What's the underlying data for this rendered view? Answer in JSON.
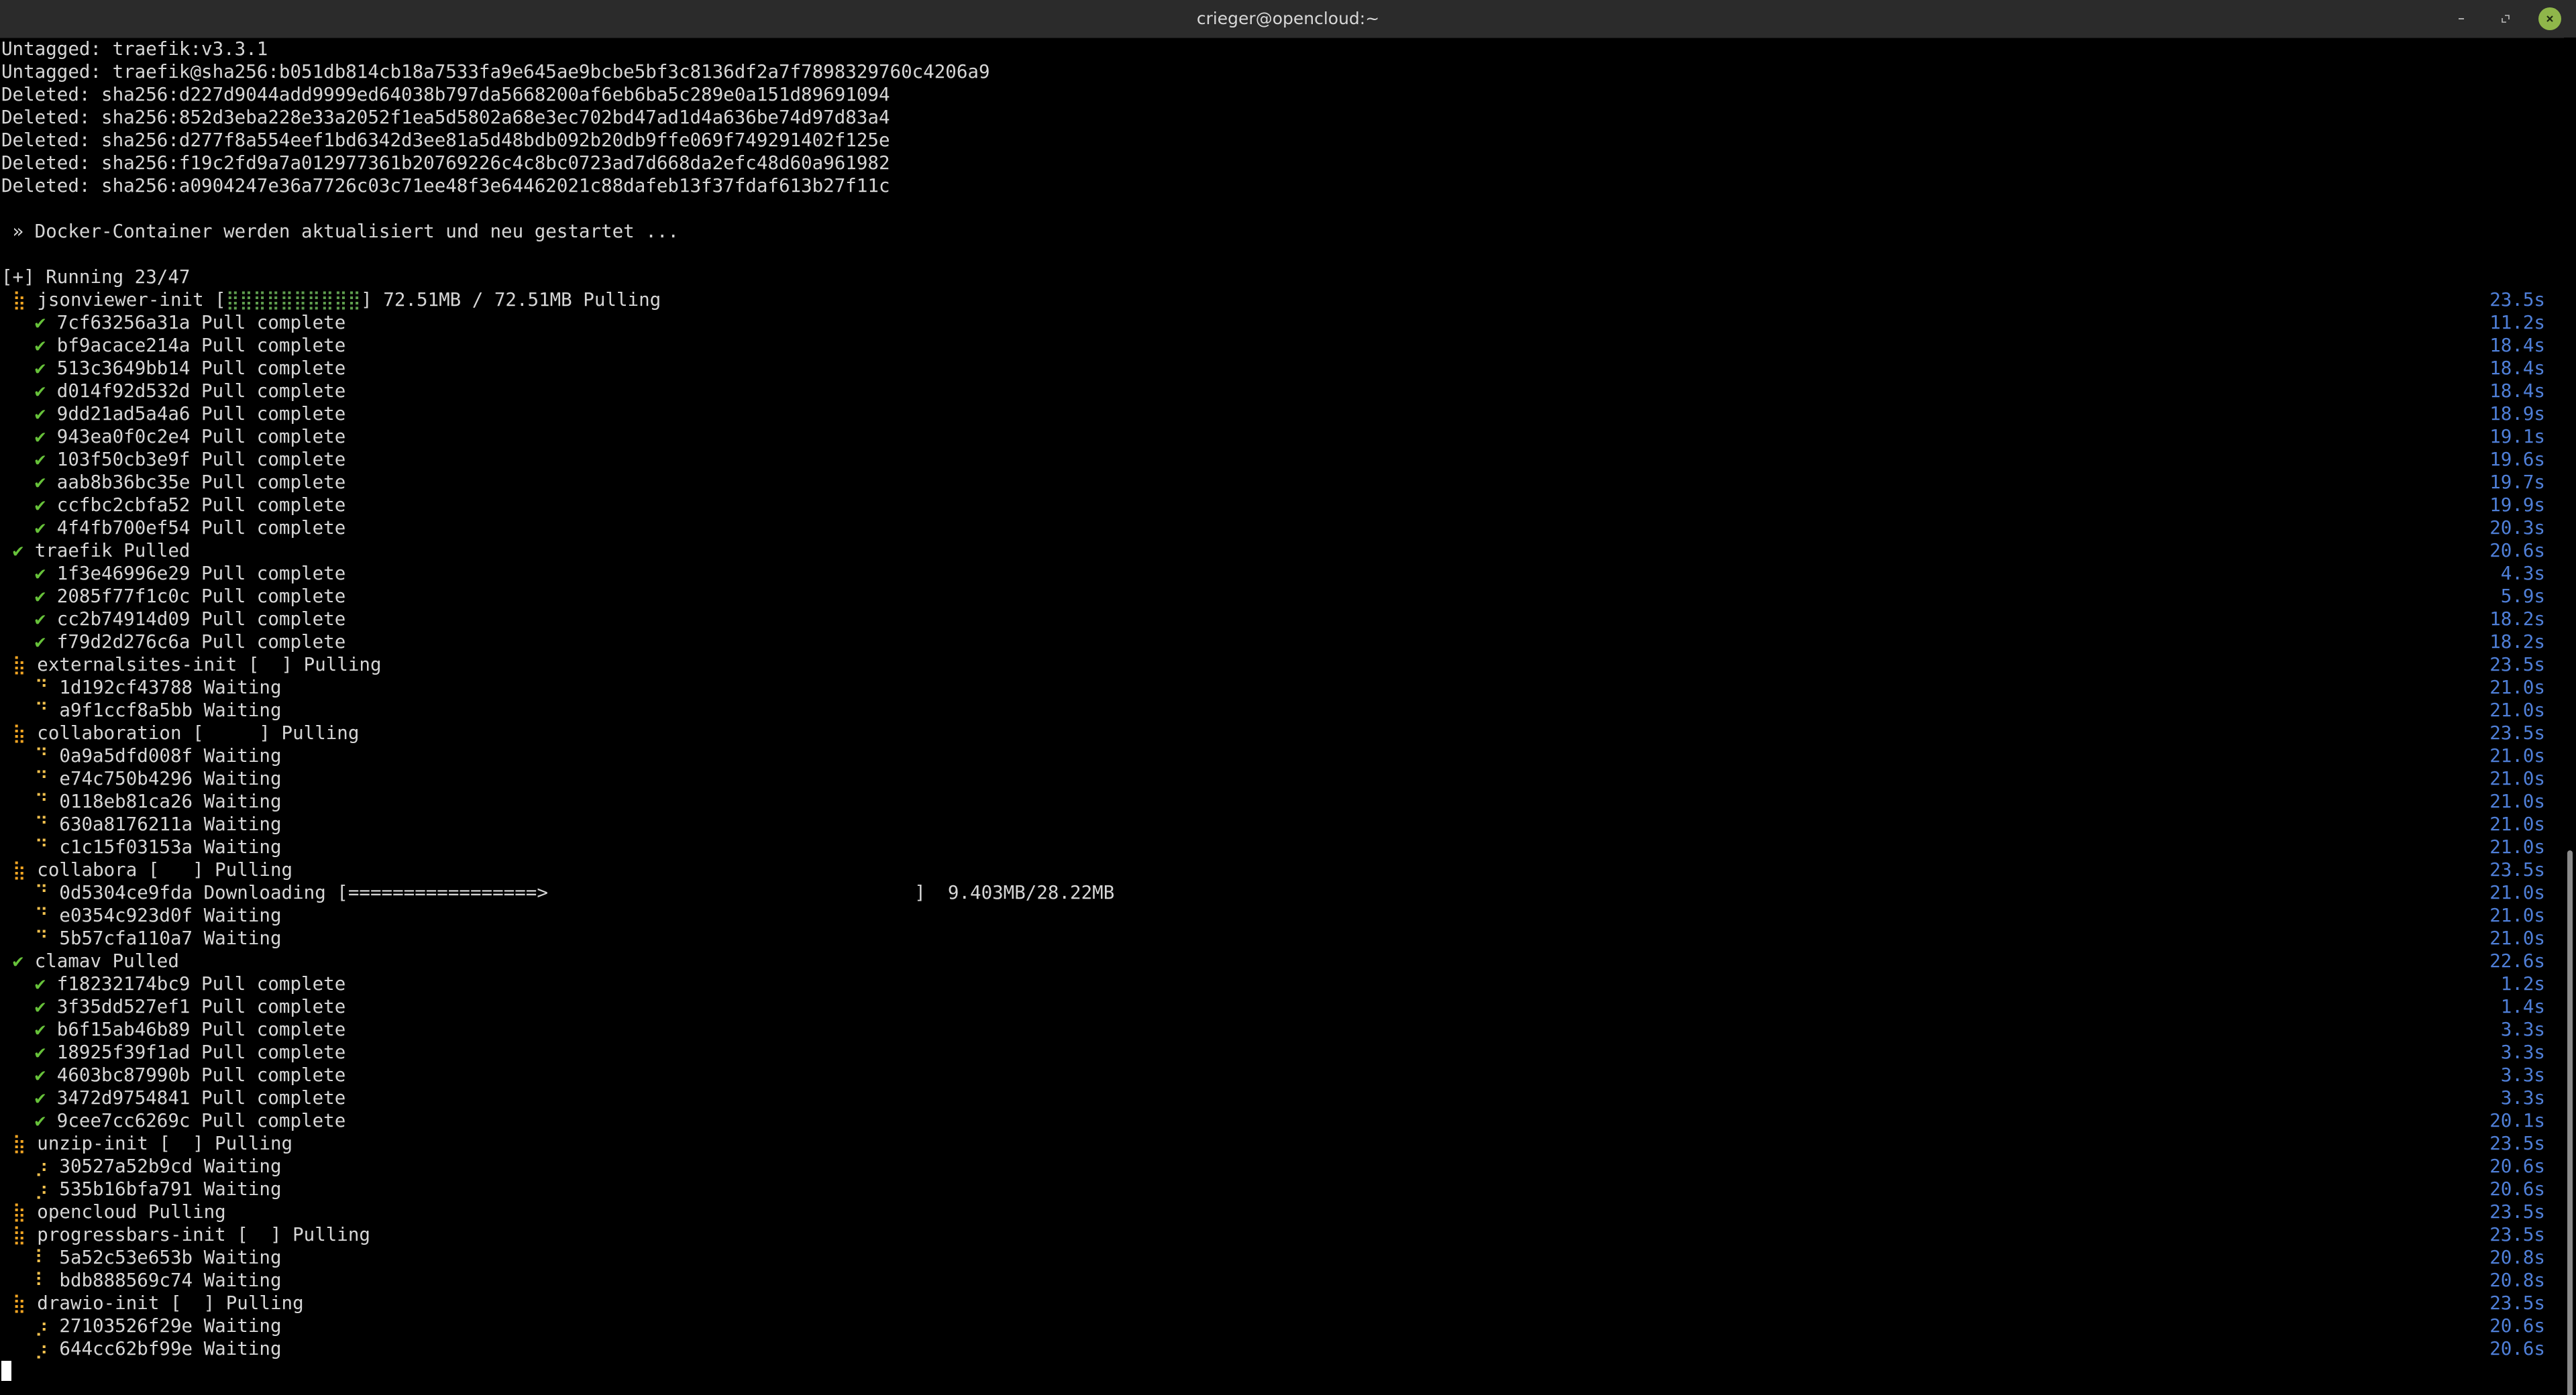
{
  "window": {
    "title": "crieger@opencloud:~"
  },
  "icons": {
    "minimize": "minimize-icon",
    "maximize": "maximize-icon",
    "close": "close-icon"
  },
  "colors": {
    "background": "#000000",
    "text": "#d6d6d6",
    "duration": "#4f7fd8",
    "check": "#67c23a",
    "spinner": "#f5a623",
    "close_button": "#8fb64a"
  },
  "terminal": {
    "pre_lines": [
      "Untagged: traefik:v3.3.1",
      "Untagged: traefik@sha256:b051db814cb18a7533fa9e645ae9bcbe5bf3c8136df2a7f7898329760c4206a9",
      "Deleted: sha256:d227d9044add9999ed64038b797da5668200af6eb6ba5c289e0a151d89691094",
      "Deleted: sha256:852d3eba228e33a2052f1ea5d5802a68e3ec702bd47ad1d4a636be74d97d83a4",
      "Deleted: sha256:d277f8a554eef1bd6342d3ee81a5d48bdb092b20db9ffe069f749291402f125e",
      "Deleted: sha256:f19c2fd9a7a012977361b20769226c4c8bc0723ad7d668da2efc48d60a961982",
      "Deleted: sha256:a0904247e36a7726c03c71ee48f3e64462021c88dafeb13f37fdaf613b27f11c",
      "",
      " » Docker-Container werden aktualisiert und neu gestartet ...",
      "",
      "[+] Running 23/47"
    ],
    "status_lines": [
      {
        "icon": "⣷",
        "kind": "spin",
        "indent": 1,
        "text": "jsonviewer-init [",
        "bar": "⣿⣿⣿⣿⣿⣿⣿⣿⣿⣿",
        "text2": "] 72.51MB / 72.51MB Pulling",
        "duration": "23.5s"
      },
      {
        "icon": "✔",
        "kind": "ok",
        "indent": 3,
        "text": "7cf63256a31a Pull complete",
        "duration": "11.2s"
      },
      {
        "icon": "✔",
        "kind": "ok",
        "indent": 3,
        "text": "bf9acace214a Pull complete",
        "duration": "18.4s"
      },
      {
        "icon": "✔",
        "kind": "ok",
        "indent": 3,
        "text": "513c3649bb14 Pull complete",
        "duration": "18.4s"
      },
      {
        "icon": "✔",
        "kind": "ok",
        "indent": 3,
        "text": "d014f92d532d Pull complete",
        "duration": "18.4s"
      },
      {
        "icon": "✔",
        "kind": "ok",
        "indent": 3,
        "text": "9dd21ad5a4a6 Pull complete",
        "duration": "18.9s"
      },
      {
        "icon": "✔",
        "kind": "ok",
        "indent": 3,
        "text": "943ea0f0c2e4 Pull complete",
        "duration": "19.1s"
      },
      {
        "icon": "✔",
        "kind": "ok",
        "indent": 3,
        "text": "103f50cb3e9f Pull complete",
        "duration": "19.6s"
      },
      {
        "icon": "✔",
        "kind": "ok",
        "indent": 3,
        "text": "aab8b36bc35e Pull complete",
        "duration": "19.7s"
      },
      {
        "icon": "✔",
        "kind": "ok",
        "indent": 3,
        "text": "ccfbc2cbfa52 Pull complete",
        "duration": "19.9s"
      },
      {
        "icon": "✔",
        "kind": "ok",
        "indent": 3,
        "text": "4f4fb700ef54 Pull complete",
        "duration": "20.3s"
      },
      {
        "icon": "✔",
        "kind": "ok",
        "indent": 1,
        "text": "traefik Pulled",
        "duration": "20.6s"
      },
      {
        "icon": "✔",
        "kind": "ok",
        "indent": 3,
        "text": "1f3e46996e29 Pull complete",
        "duration": "4.3s"
      },
      {
        "icon": "✔",
        "kind": "ok",
        "indent": 3,
        "text": "2085f77f1c0c Pull complete",
        "duration": "5.9s"
      },
      {
        "icon": "✔",
        "kind": "ok",
        "indent": 3,
        "text": "cc2b74914d09 Pull complete",
        "duration": "18.2s"
      },
      {
        "icon": "✔",
        "kind": "ok",
        "indent": 3,
        "text": "f79d2d276c6a Pull complete",
        "duration": "18.2s"
      },
      {
        "icon": "⣷",
        "kind": "spin",
        "indent": 1,
        "text": "externalsites-init [  ] Pulling",
        "duration": "23.5s"
      },
      {
        "icon": "⠙",
        "kind": "wait",
        "indent": 3,
        "text": "1d192cf43788 Waiting",
        "duration": "21.0s"
      },
      {
        "icon": "⠙",
        "kind": "wait",
        "indent": 3,
        "text": "a9f1ccf8a5bb Waiting",
        "duration": "21.0s"
      },
      {
        "icon": "⣷",
        "kind": "spin",
        "indent": 1,
        "text": "collaboration [     ] Pulling",
        "duration": "23.5s"
      },
      {
        "icon": "⠙",
        "kind": "wait",
        "indent": 3,
        "text": "0a9a5dfd008f Waiting",
        "duration": "21.0s"
      },
      {
        "icon": "⠙",
        "kind": "wait",
        "indent": 3,
        "text": "e74c750b4296 Waiting",
        "duration": "21.0s"
      },
      {
        "icon": "⠙",
        "kind": "wait",
        "indent": 3,
        "text": "0118eb81ca26 Waiting",
        "duration": "21.0s"
      },
      {
        "icon": "⠙",
        "kind": "wait",
        "indent": 3,
        "text": "630a8176211a Waiting",
        "duration": "21.0s"
      },
      {
        "icon": "⠙",
        "kind": "wait",
        "indent": 3,
        "text": "c1c15f03153a Waiting",
        "duration": "21.0s"
      },
      {
        "icon": "⣷",
        "kind": "spin",
        "indent": 1,
        "text": "collabora [   ] Pulling",
        "duration": "23.5s"
      },
      {
        "icon": "⠙",
        "kind": "wait",
        "indent": 3,
        "text": "0d5304ce9fda Downloading [=================>                                 ]  9.403MB/28.22MB",
        "duration": "21.0s"
      },
      {
        "icon": "⠙",
        "kind": "wait",
        "indent": 3,
        "text": "e0354c923d0f Waiting",
        "duration": "21.0s"
      },
      {
        "icon": "⠙",
        "kind": "wait",
        "indent": 3,
        "text": "5b57cfa110a7 Waiting",
        "duration": "21.0s"
      },
      {
        "icon": "✔",
        "kind": "ok",
        "indent": 1,
        "text": "clamav Pulled",
        "duration": "22.6s"
      },
      {
        "icon": "✔",
        "kind": "ok",
        "indent": 3,
        "text": "f18232174bc9 Pull complete",
        "duration": "1.2s"
      },
      {
        "icon": "✔",
        "kind": "ok",
        "indent": 3,
        "text": "3f35dd527ef1 Pull complete",
        "duration": "1.4s"
      },
      {
        "icon": "✔",
        "kind": "ok",
        "indent": 3,
        "text": "b6f15ab46b89 Pull complete",
        "duration": "3.3s"
      },
      {
        "icon": "✔",
        "kind": "ok",
        "indent": 3,
        "text": "18925f39f1ad Pull complete",
        "duration": "3.3s"
      },
      {
        "icon": "✔",
        "kind": "ok",
        "indent": 3,
        "text": "4603bc87990b Pull complete",
        "duration": "3.3s"
      },
      {
        "icon": "✔",
        "kind": "ok",
        "indent": 3,
        "text": "3472d9754841 Pull complete",
        "duration": "3.3s"
      },
      {
        "icon": "✔",
        "kind": "ok",
        "indent": 3,
        "text": "9cee7cc6269c Pull complete",
        "duration": "20.1s"
      },
      {
        "icon": "⣷",
        "kind": "spin",
        "indent": 1,
        "text": "unzip-init [  ] Pulling",
        "duration": "23.5s"
      },
      {
        "icon": "⡰",
        "kind": "wait",
        "indent": 3,
        "text": "30527a52b9cd Waiting",
        "duration": "20.6s"
      },
      {
        "icon": "⡰",
        "kind": "wait",
        "indent": 3,
        "text": "535b16bfa791 Waiting",
        "duration": "20.6s"
      },
      {
        "icon": "⣷",
        "kind": "spin",
        "indent": 1,
        "text": "opencloud Pulling",
        "duration": "23.5s"
      },
      {
        "icon": "⣷",
        "kind": "spin",
        "indent": 1,
        "text": "progressbars-init [  ] Pulling",
        "duration": "23.5s"
      },
      {
        "icon": "⠇",
        "kind": "wait",
        "indent": 3,
        "text": "5a52c53e653b Waiting",
        "duration": "20.8s"
      },
      {
        "icon": "⠇",
        "kind": "wait",
        "indent": 3,
        "text": "bdb888569c74 Waiting",
        "duration": "20.8s"
      },
      {
        "icon": "⣷",
        "kind": "spin",
        "indent": 1,
        "text": "drawio-init [  ] Pulling",
        "duration": "23.5s"
      },
      {
        "icon": "⡰",
        "kind": "wait",
        "indent": 3,
        "text": "27103526f29e Waiting",
        "duration": "20.6s"
      },
      {
        "icon": "⡰",
        "kind": "wait",
        "indent": 3,
        "text": "644cc62bf99e Waiting",
        "duration": "20.6s"
      }
    ]
  }
}
